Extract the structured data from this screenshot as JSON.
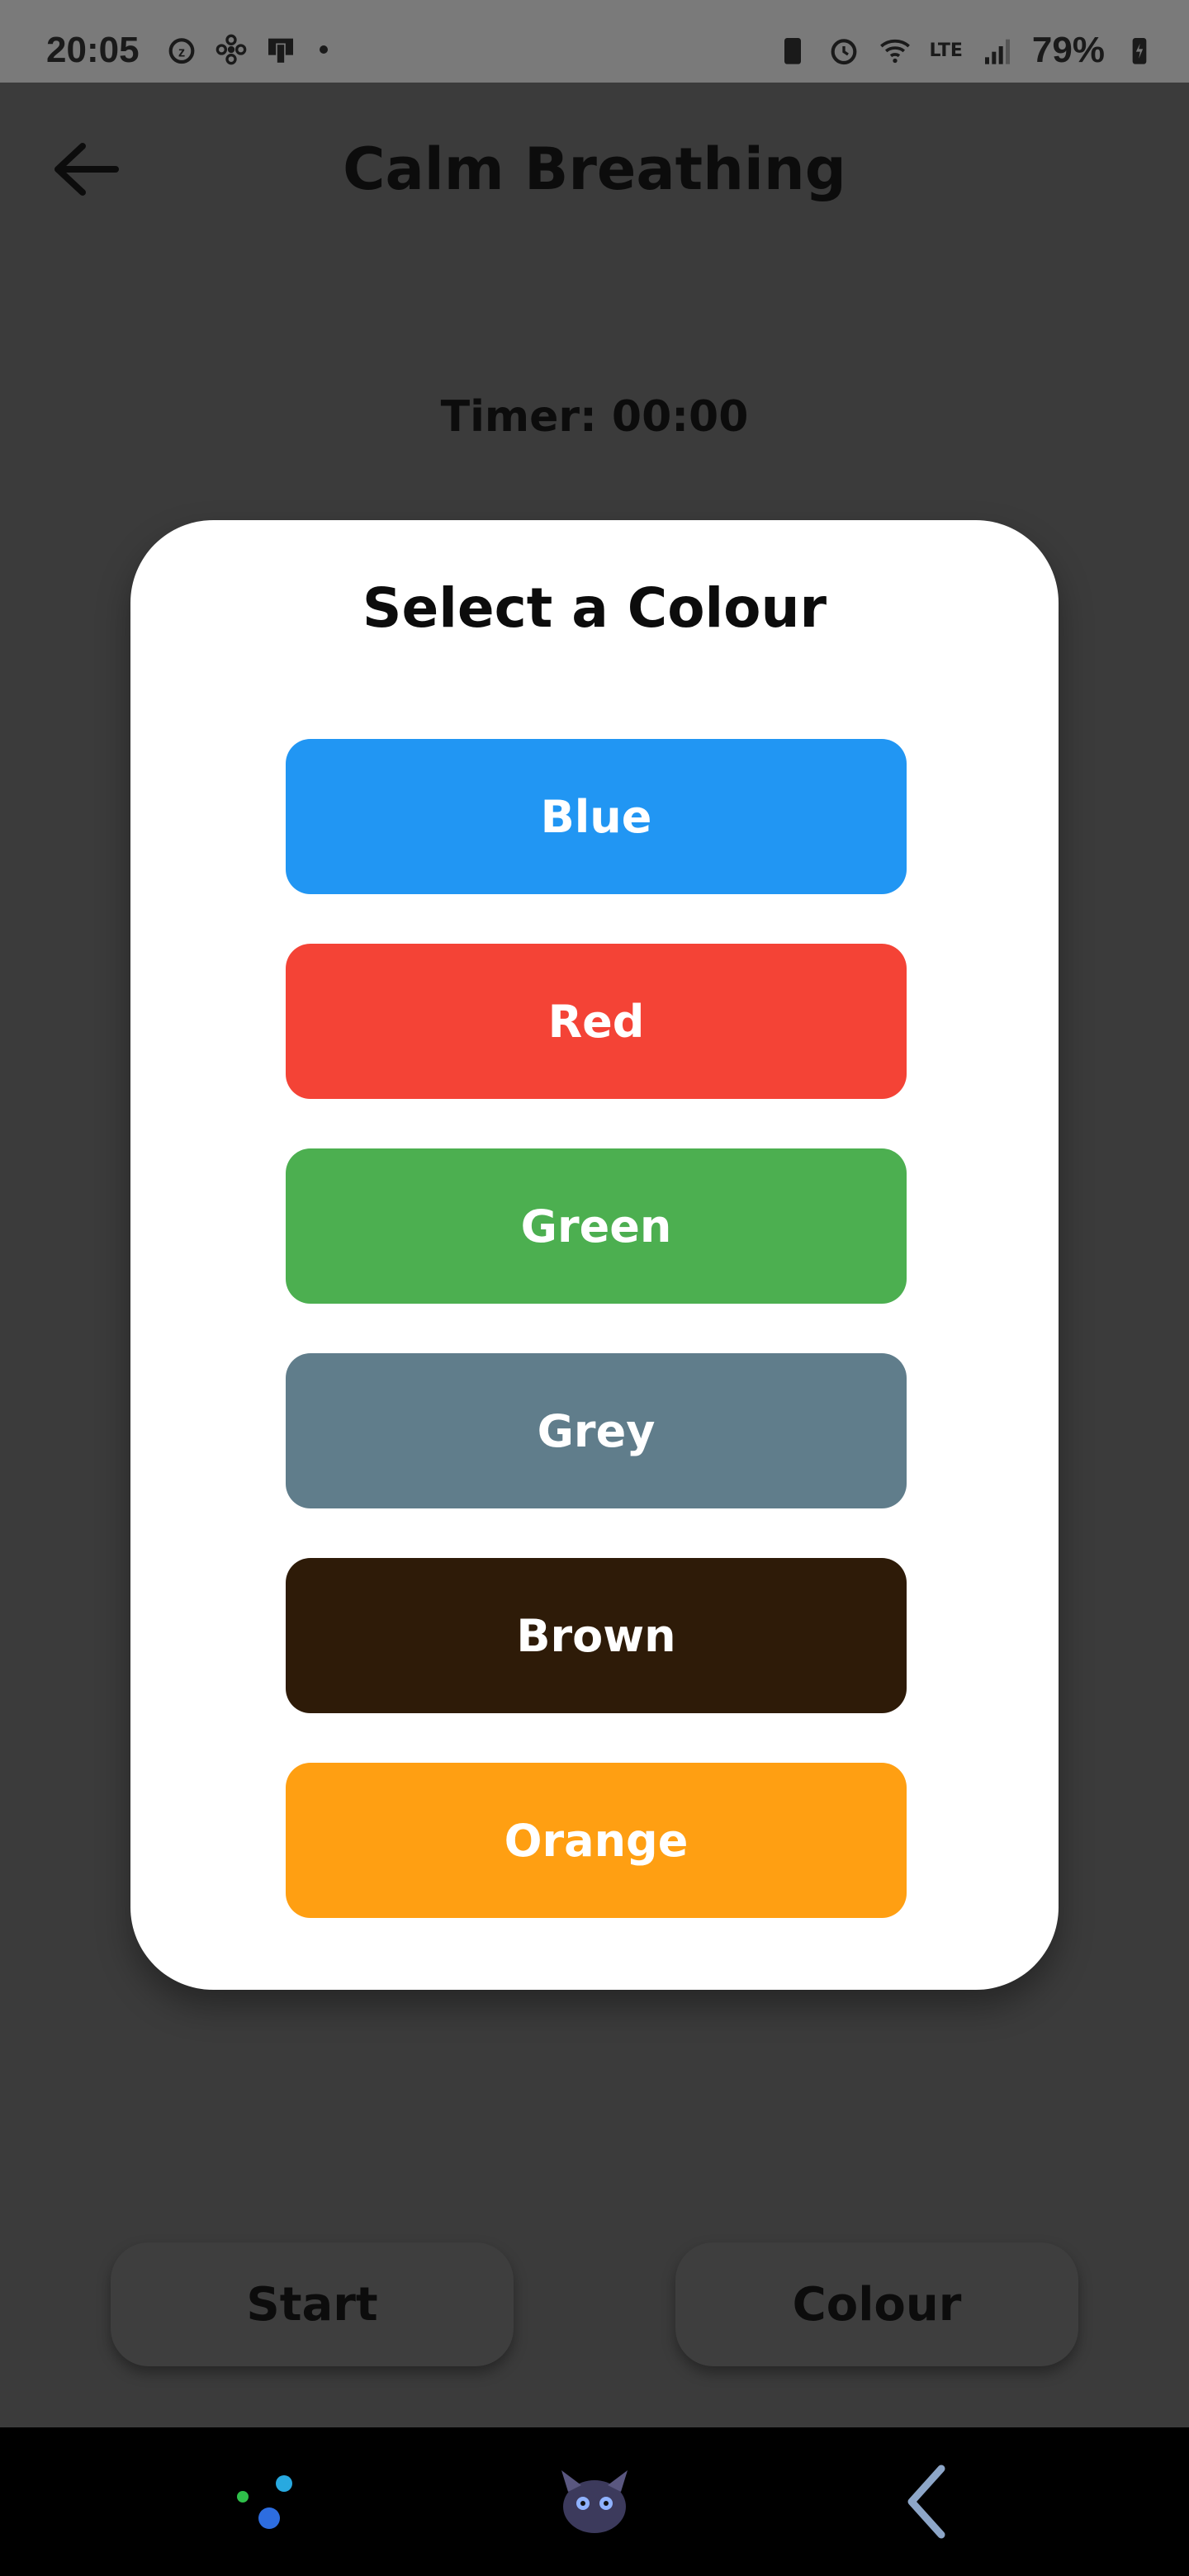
{
  "status_bar": {
    "time": "20:05",
    "battery": "79%",
    "network": "LTE"
  },
  "header": {
    "title": "Calm Breathing",
    "back_icon": "arrow-left-icon"
  },
  "timer": {
    "label": "Timer: 00:00"
  },
  "modal": {
    "title": "Select a Colour",
    "options": [
      {
        "label": "Blue",
        "color": "#2196F3"
      },
      {
        "label": "Red",
        "color": "#F44336"
      },
      {
        "label": "Green",
        "color": "#4CAF50"
      },
      {
        "label": "Grey",
        "color": "#607D8B"
      },
      {
        "label": "Brown",
        "color": "#2E1B08"
      },
      {
        "label": "Orange",
        "color": "#FF9F12"
      }
    ]
  },
  "controls": {
    "start_label": "Start",
    "colour_label": "Colour"
  },
  "nav_bar": {
    "items": [
      "stars-icon",
      "dragon-icon",
      "back-gesture-icon"
    ]
  }
}
